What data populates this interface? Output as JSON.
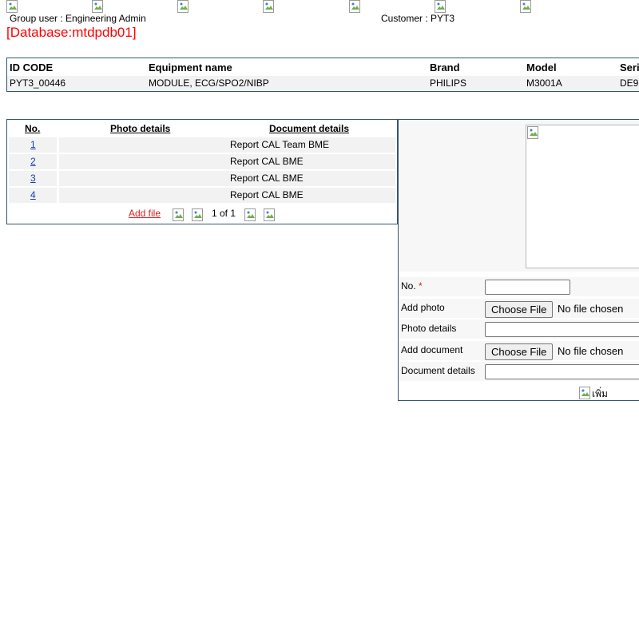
{
  "header": {
    "group_user": "Group user : Engineering Admin",
    "customer": "Customer : PYT3",
    "database": "[Database:mtdpdb01]"
  },
  "equipment": {
    "columns": [
      "ID CODE",
      "Equipment name",
      "Brand",
      "Model",
      "Seri"
    ],
    "row": [
      "PYT3_00446",
      "MODULE, ECG/SPO2/NIBP",
      "PHILIPS",
      "M3001A",
      "DE9"
    ]
  },
  "files": {
    "columns": [
      "No.",
      "Photo details",
      "Document details"
    ],
    "rows": [
      {
        "no": "1",
        "photo": "",
        "document": "Report CAL Team BME"
      },
      {
        "no": "2",
        "photo": "",
        "document": "Report CAL BME"
      },
      {
        "no": "3",
        "photo": "",
        "document": "Report CAL BME"
      },
      {
        "no": "4",
        "photo": "",
        "document": "Report CAL BME"
      }
    ],
    "add_file": "Add file",
    "page_info": "1 of 1"
  },
  "form": {
    "no_label": "No.",
    "required_mark": "*",
    "add_photo_label": "Add photo",
    "photo_details_label": "Photo details",
    "add_document_label": "Add document",
    "document_details_label": "Document details",
    "choose_file": "Choose File",
    "no_file_chosen": "No file chosen",
    "submit_label": "เพิ่ม"
  },
  "icons": {
    "broken_image": "broken-image-icon",
    "first_page": "first-page-icon",
    "prev_page": "prev-page-icon",
    "next_page": "next-page-icon",
    "last_page": "last-page-icon"
  },
  "colors": {
    "border": "#34566f",
    "database_text": "#ff0000",
    "link": "#1a3fb0",
    "add_file": "#e01d1d",
    "row_bg": "#f2f2f2"
  }
}
